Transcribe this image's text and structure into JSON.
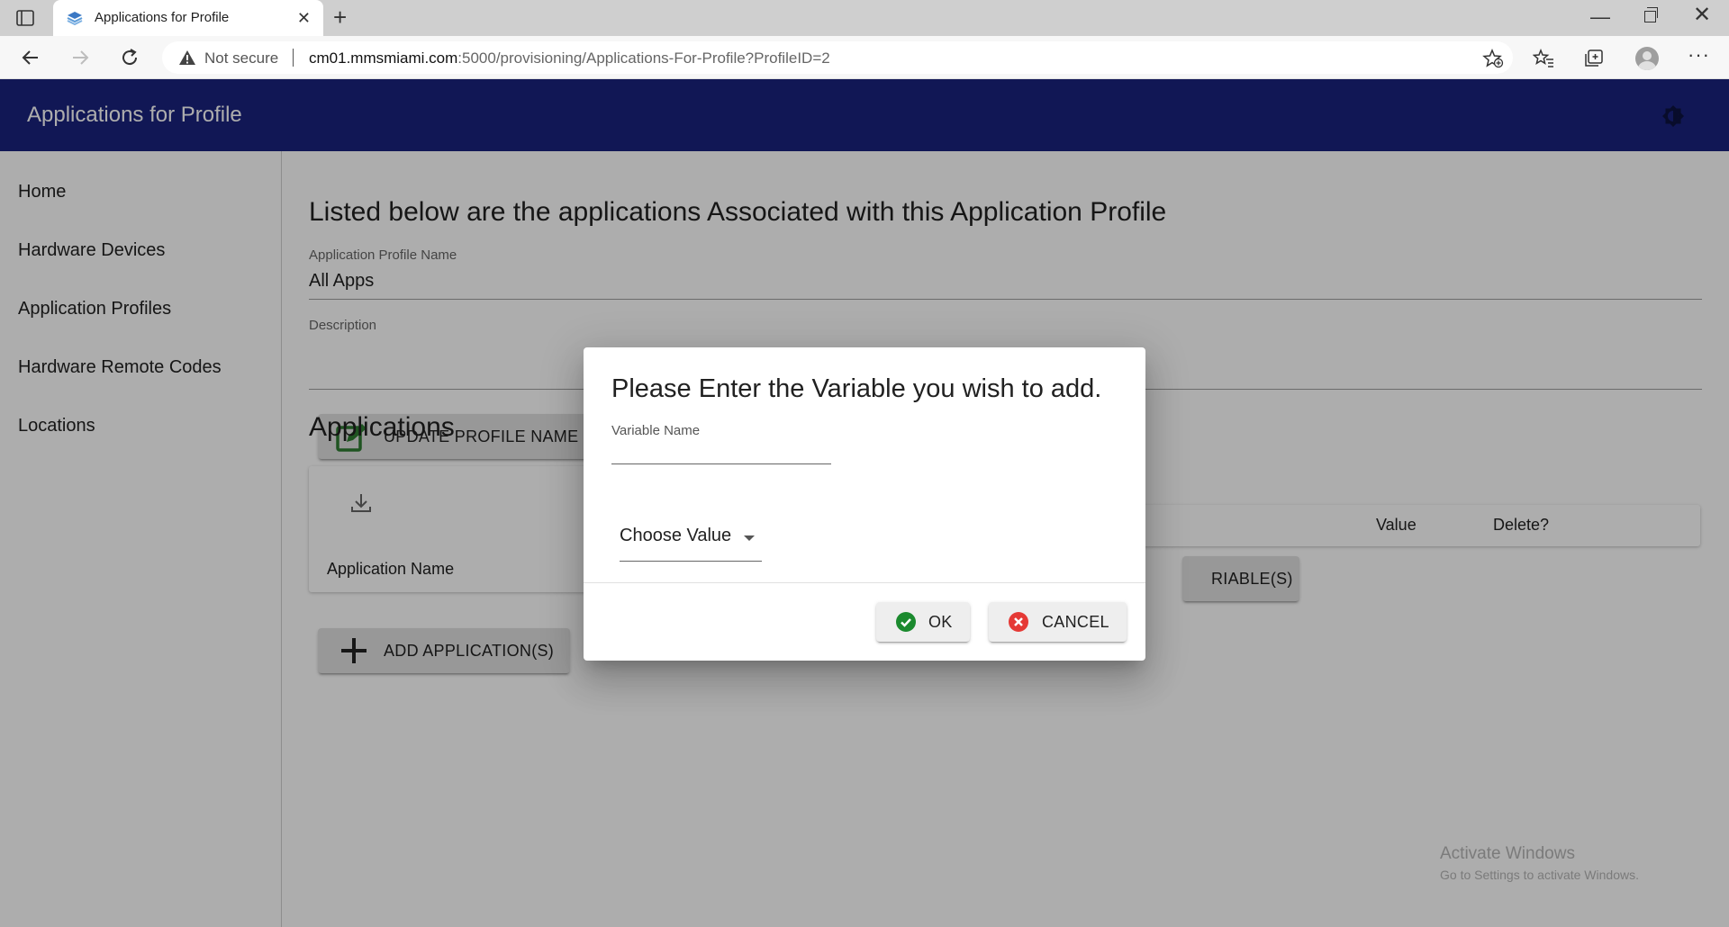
{
  "browser": {
    "tab_title": "Applications for Profile",
    "new_tab_label": "+",
    "not_secure_label": "Not secure",
    "url_host": "cm01.mmsmiami.com",
    "url_rest": ":5000/provisioning/Applications-For-Profile?ProfileID=2"
  },
  "app": {
    "title": "Applications for Profile"
  },
  "sidebar": {
    "items": [
      {
        "label": "Home"
      },
      {
        "label": "Hardware Devices"
      },
      {
        "label": "Application Profiles"
      },
      {
        "label": "Hardware Remote Codes"
      },
      {
        "label": "Locations"
      }
    ]
  },
  "main": {
    "heading": "Listed below are the applications Associated with this Application Profile",
    "profile_name_label": "Application Profile Name",
    "profile_name_value": "All Apps",
    "description_label": "Description",
    "description_value": "",
    "update_button": "UPDATE PROFILE NAME",
    "applications_heading": "Applications",
    "app_table": {
      "columns": [
        "Application Name"
      ]
    },
    "add_app_button": "ADD APPLICATION(S)",
    "variables_table": {
      "columns": [
        "Value",
        "Delete?"
      ]
    },
    "add_variable_button_partial": "RIABLE(S)"
  },
  "dialog": {
    "title": "Please Enter the Variable you wish to add.",
    "variable_label": "Variable Name",
    "variable_value": "",
    "select_value": "Choose Value",
    "ok_label": "OK",
    "cancel_label": "CANCEL"
  },
  "watermark": {
    "line1": "Activate Windows",
    "line2": "Go to Settings to activate Windows."
  },
  "colors": {
    "appbar": "#1a237e",
    "ok_green": "#1b8a2e",
    "cancel_red": "#e53935"
  }
}
